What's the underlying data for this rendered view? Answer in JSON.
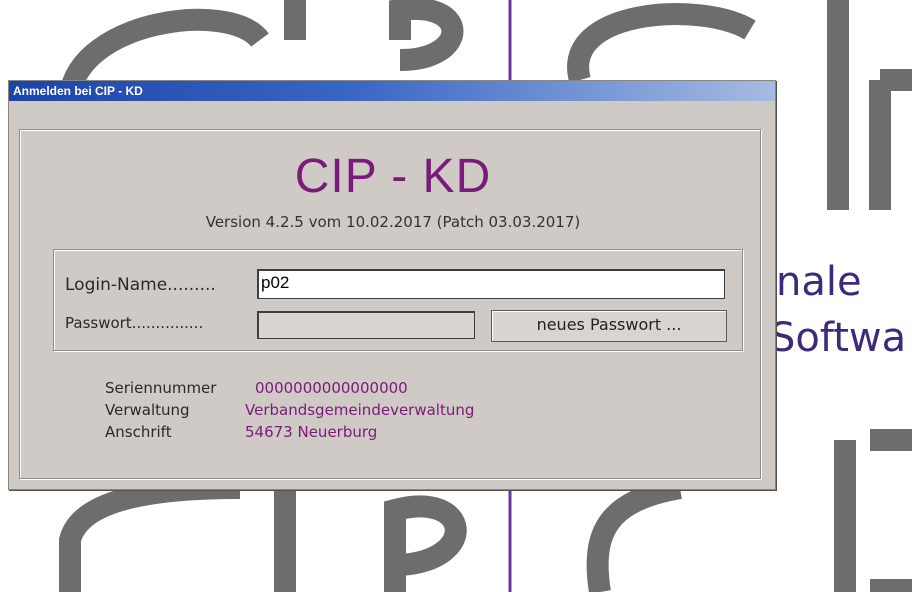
{
  "background": {
    "logo_text": "CIP",
    "side_line1": "nale",
    "side_line2": "Softwa"
  },
  "dialog": {
    "title": "Anmelden bei CIP - KD",
    "app_name": "CIP - KD",
    "version": "Version 4.2.5 vom 10.02.2017 (Patch 03.03.2017)",
    "login": {
      "name_label": "Login-Name.........",
      "name_value": "p02",
      "password_label": "Passwort...............",
      "password_value": "",
      "new_password_button": "neues Passwort ..."
    },
    "info": {
      "serial_label": "Seriennummer",
      "serial_value": "0000000000000000",
      "admin_label": "Verwaltung",
      "admin_value": "Verbandsgemeindeverwaltung",
      "address_label": "Anschrift",
      "address_value": "54673 Neuerburg"
    }
  },
  "colors": {
    "accent_purple": "#7a1a7a",
    "title_blue": "#1c44a8",
    "background_logo": "#6d6d6d"
  }
}
